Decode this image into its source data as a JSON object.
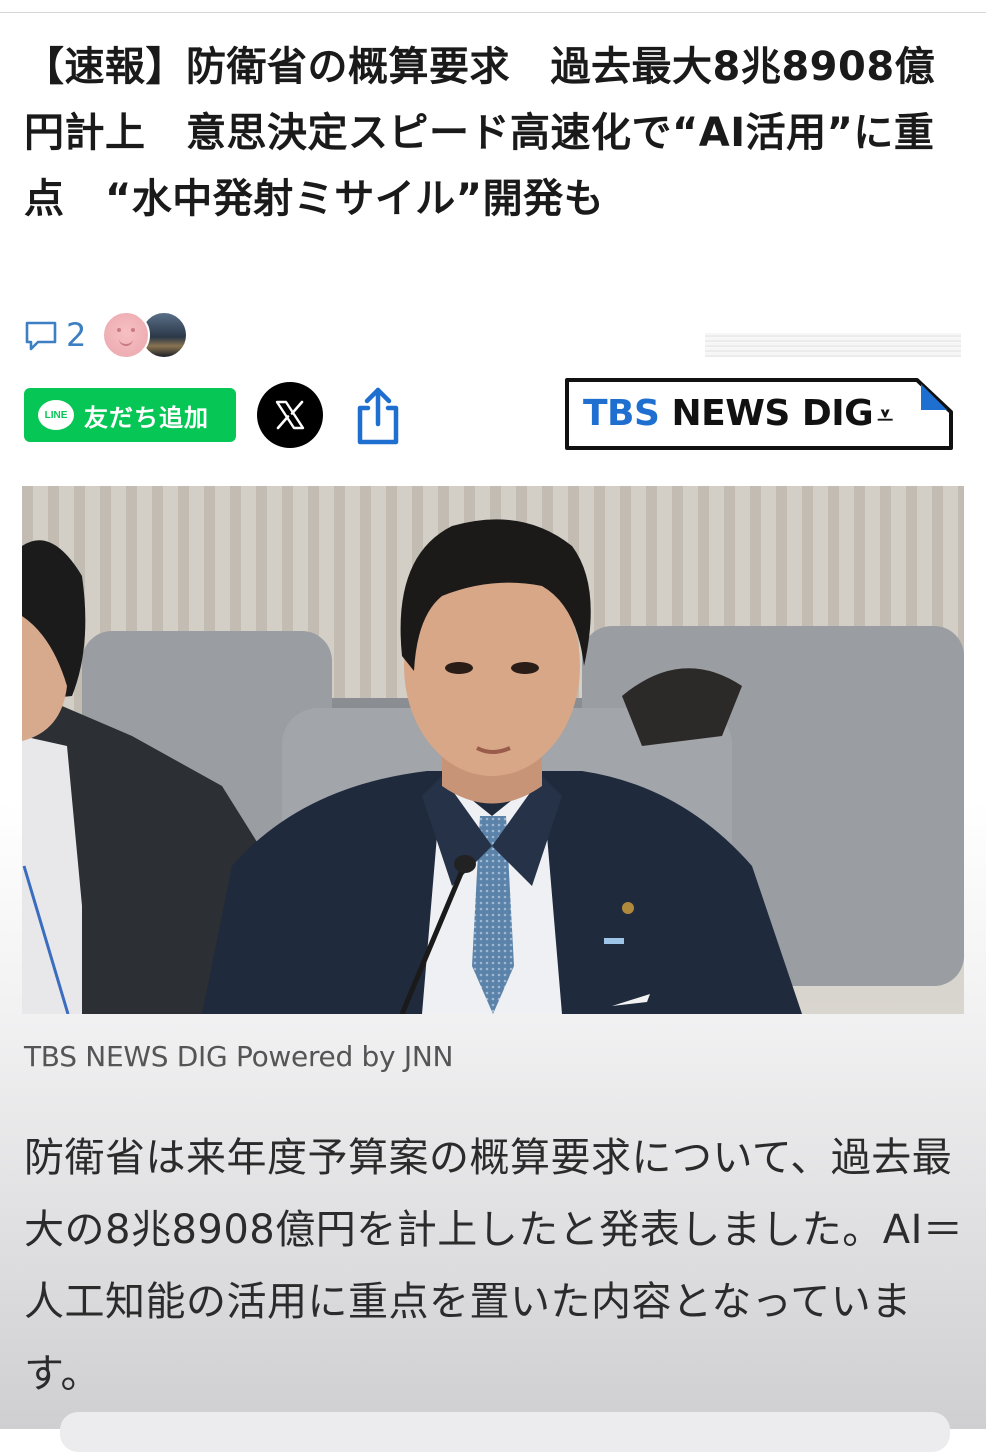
{
  "article": {
    "title": "【速報】防衛省の概算要求　過去最大8兆8908億円計上　意思決定スピード高速化で“AI活用”に重点　“水中発射ミサイル”開発も",
    "comment_count": "2",
    "share": {
      "line_badge": "LINE",
      "line_label": "友だち追加"
    },
    "source_logo": {
      "part1": "TBS",
      "part2": " NEWS DIG"
    },
    "photo_caption": "TBS NEWS DIG Powered by JNN",
    "lead": "防衛省は来年度予算案の概算要求について、過去最大の8兆8908億円を計上したと発表しました。AI＝人工知能の活用に重点を置いた内容となっています。"
  },
  "colors": {
    "line_green": "#06c755",
    "comment_blue": "#3d7fc3",
    "tbs_blue": "#1e6fd0"
  },
  "icons": [
    "comment-icon",
    "x-logo-icon",
    "share-icon",
    "line-logo-icon"
  ]
}
